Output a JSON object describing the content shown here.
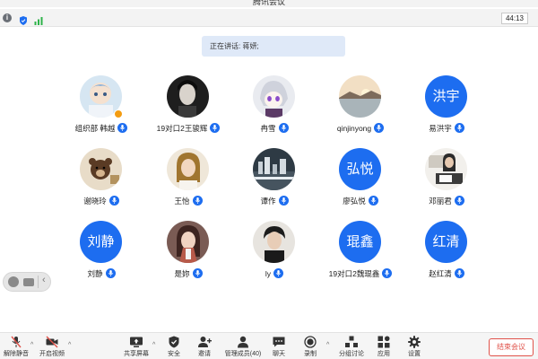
{
  "window": {
    "title": "腾讯会议"
  },
  "infobar": {
    "icons": [
      "info-icon",
      "shield-icon",
      "signal-icon"
    ],
    "timer": "44:13"
  },
  "speaking": {
    "text": "正在讲话: 蒋妍;"
  },
  "participants": [
    {
      "name": "组织部  韩越",
      "avatar_type": "photo",
      "avatar_icon": "photo-avatar-cartoon",
      "host": true
    },
    {
      "name": "19对口2王骏辉",
      "avatar_type": "photo",
      "avatar_icon": "photo-avatar-portrait"
    },
    {
      "name": "冉雪",
      "avatar_type": "photo",
      "avatar_icon": "photo-avatar-anime"
    },
    {
      "name": "qinjinyong",
      "avatar_type": "photo",
      "avatar_icon": "photo-avatar-sunset"
    },
    {
      "name": "易洪宇",
      "avatar_type": "text",
      "avatar_text": "洪宇"
    },
    {
      "name": "谢晓玲",
      "avatar_type": "photo",
      "avatar_icon": "photo-avatar-bear"
    },
    {
      "name": "王怡",
      "avatar_type": "photo",
      "avatar_icon": "photo-avatar-girl"
    },
    {
      "name": "谭作",
      "avatar_type": "photo",
      "avatar_icon": "photo-avatar-city"
    },
    {
      "name": "廖弘悦",
      "avatar_type": "text",
      "avatar_text": "弘悦"
    },
    {
      "name": "邓丽君",
      "avatar_type": "photo",
      "avatar_icon": "photo-avatar-desk"
    },
    {
      "name": "刘静",
      "avatar_type": "text",
      "avatar_text": "刘静"
    },
    {
      "name": "是妳",
      "avatar_type": "photo",
      "avatar_icon": "photo-avatar-woman"
    },
    {
      "name": "ly",
      "avatar_type": "photo",
      "avatar_icon": "photo-avatar-boy"
    },
    {
      "name": "19对口2魏琨鑫",
      "avatar_type": "text",
      "avatar_text": "琨鑫"
    },
    {
      "name": "赵红清",
      "avatar_type": "text",
      "avatar_text": "红清"
    }
  ],
  "toolbar": {
    "unmute": "解除静音",
    "video": "开启视频",
    "share": "共享屏幕",
    "security": "安全",
    "invite": "邀请",
    "members": "管理成员(40)",
    "chat": "聊天",
    "record": "录制",
    "breakout": "分组讨论",
    "apps": "应用",
    "settings": "设置",
    "end": "结束会议"
  },
  "colors": {
    "accent": "#1d6df0",
    "end": "#e0524a",
    "speaking_bg": "#dfe9f8"
  }
}
